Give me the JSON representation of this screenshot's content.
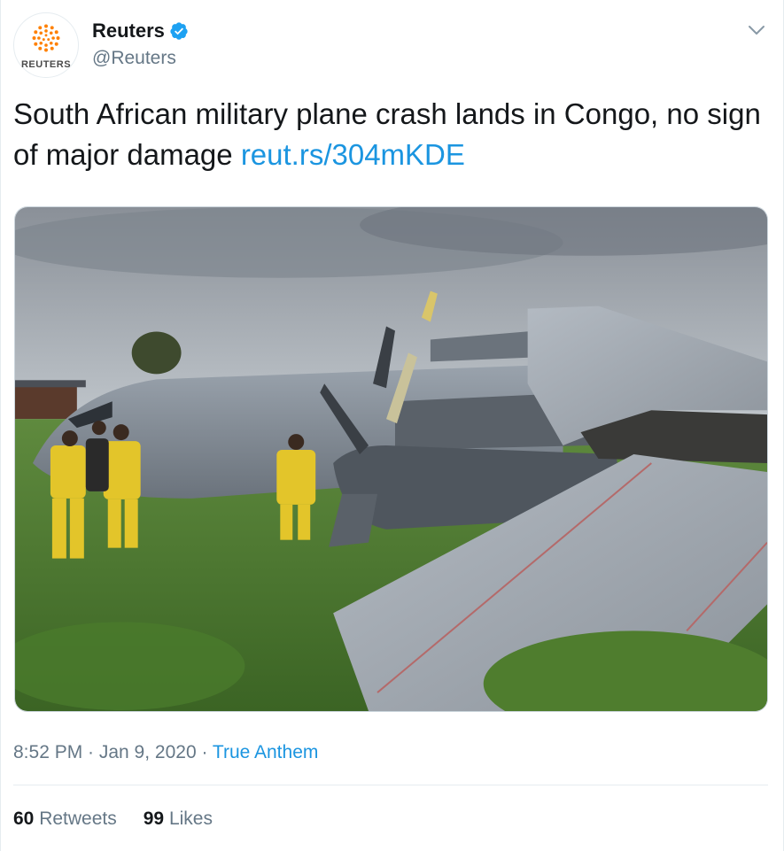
{
  "account": {
    "display_name": "Reuters",
    "handle": "@Reuters",
    "logo_text": "REUTERS",
    "verified": true
  },
  "tweet": {
    "text": "South African military plane crash lands in Congo, no sign of major damage ",
    "link": "reut.rs/304mKDE",
    "time": "8:52 PM · Jan 9, 2020 · ",
    "source": "True Anthem"
  },
  "stats": {
    "retweets_count": "60",
    "retweets_label": "Retweets",
    "likes_count": "99",
    "likes_label": "Likes"
  },
  "colors": {
    "link": "#1b95e0",
    "verified": "#1da1f2",
    "reuters_orange": "#ff8000",
    "secondary_text": "#657786"
  },
  "icons": {
    "verified": "verified-badge-icon",
    "caret": "chevron-down-icon",
    "logo": "reuters-logo-icon"
  }
}
